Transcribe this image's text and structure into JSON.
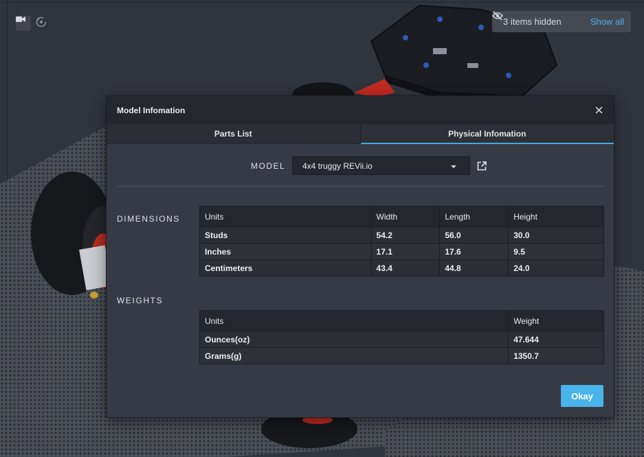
{
  "viewport": {
    "icons": {
      "camera": "video-camera-icon",
      "reset": "reset-view-icon",
      "hidden": "eye-off-icon"
    },
    "hidden_items_text": "3 items hidden",
    "show_all_label": "Show all"
  },
  "modal": {
    "title": "Model Infomation",
    "tabs": [
      {
        "label": "Parts List",
        "active": false
      },
      {
        "label": "Physical Infomation",
        "active": true
      }
    ],
    "model_label": "MODEL",
    "model_value": "4x4 truggy REVii.io",
    "dimensions": {
      "label": "DIMENSIONS",
      "headers": [
        "Units",
        "Width",
        "Length",
        "Height"
      ],
      "rows": [
        [
          "Studs",
          "54.2",
          "56.0",
          "30.0"
        ],
        [
          "Inches",
          "17.1",
          "17.6",
          "9.5"
        ],
        [
          "Centimeters",
          "43.4",
          "44.8",
          "24.0"
        ]
      ]
    },
    "weights": {
      "label": "WEIGHTS",
      "headers": [
        "Units",
        "Weight"
      ],
      "rows": [
        [
          "Ounces(oz)",
          "47.644"
        ],
        [
          "Grams(g)",
          "1350.7"
        ]
      ]
    },
    "okay_label": "Okay"
  },
  "colors": {
    "accent": "#48b4ea",
    "link": "#4eb0e6",
    "header_bg": "#24272d",
    "modal_bg": "#363a44"
  }
}
